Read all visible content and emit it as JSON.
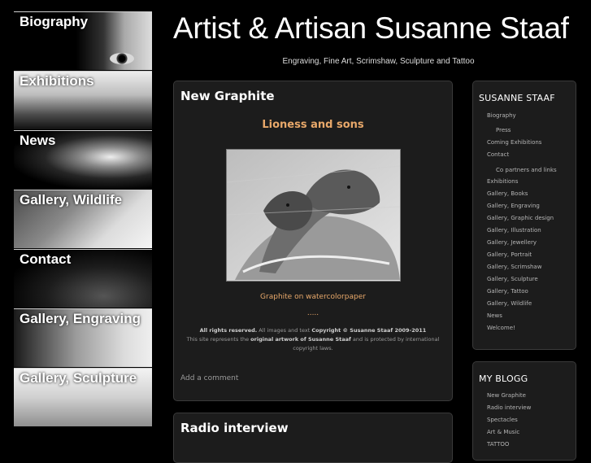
{
  "site": {
    "title": "Artist & Artisan Susanne Staaf",
    "tagline": "Engraving, Fine Art, Scrimshaw, Sculpture and Tattoo"
  },
  "left_nav": [
    {
      "label": "Biography"
    },
    {
      "label": "Exhibitions"
    },
    {
      "label": "News"
    },
    {
      "label": "Gallery, Wildlife"
    },
    {
      "label": "Contact"
    },
    {
      "label": "Gallery, Engraving"
    },
    {
      "label": "Gallery, Sculpture"
    }
  ],
  "post1": {
    "title": "New Graphite",
    "subtitle": "Lioness and sons",
    "caption": "Graphite on watercolorpaper",
    "dots": ".....",
    "rights_a": "All rights reserved.",
    "rights_b": " All images and text ",
    "rights_c": "Copyright © Susanne Staaf 2009-2011",
    "rights_d": "This site represents the ",
    "rights_e": "original artwork of Susanne Staaf",
    "rights_f": " and is protected by international copyright laws.",
    "comment": "Add a comment"
  },
  "post2": {
    "title": "Radio interview"
  },
  "sidebar": {
    "menu_title": "SUSANNE STAAF",
    "menu": [
      {
        "label": "Biography",
        "sub": false
      },
      {
        "label": "Press",
        "sub": true
      },
      {
        "label": "Coming Exhibitions",
        "sub": false
      },
      {
        "label": "Contact",
        "sub": false
      },
      {
        "label": "Co partners and links",
        "sub": true
      },
      {
        "label": "Exhibitions",
        "sub": false
      },
      {
        "label": "Gallery, Books",
        "sub": false
      },
      {
        "label": "Gallery, Engraving",
        "sub": false
      },
      {
        "label": "Gallery, Graphic design",
        "sub": false
      },
      {
        "label": "Gallery, Illustration",
        "sub": false
      },
      {
        "label": "Gallery, Jewellery",
        "sub": false
      },
      {
        "label": "Gallery, Portrait",
        "sub": false
      },
      {
        "label": "Gallery, Scrimshaw",
        "sub": false
      },
      {
        "label": "Gallery, Sculpture",
        "sub": false
      },
      {
        "label": "Gallery, Tattoo",
        "sub": false
      },
      {
        "label": "Gallery, Wildlife",
        "sub": false
      },
      {
        "label": "News",
        "sub": false
      },
      {
        "label": "Welcome!",
        "sub": false
      }
    ],
    "blog_title": "MY BLOGG",
    "blog": [
      {
        "label": "New Graphite"
      },
      {
        "label": "Radio interview"
      },
      {
        "label": "Spectacles"
      },
      {
        "label": "Art & Music"
      },
      {
        "label": "TATTOO"
      }
    ]
  },
  "colors": {
    "background": "#000000",
    "panel": "#1c1c1c",
    "accent": "#e8a86a",
    "link": "#b5b5b5"
  }
}
